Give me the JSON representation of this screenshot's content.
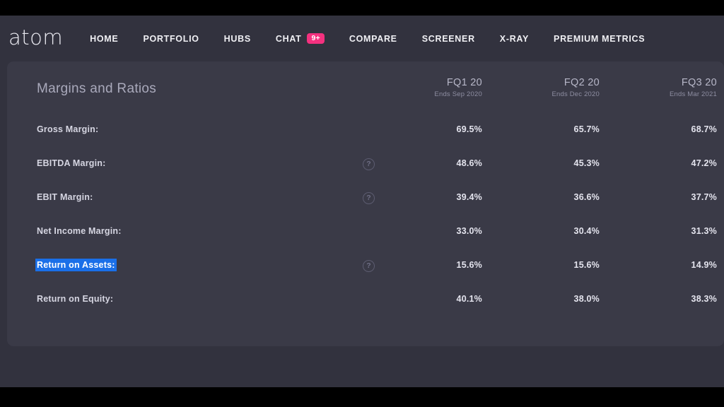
{
  "brand": {
    "logo": "atom"
  },
  "nav": {
    "items": [
      {
        "label": "HOME",
        "badge": null
      },
      {
        "label": "PORTFOLIO",
        "badge": null
      },
      {
        "label": "HUBS",
        "badge": null
      },
      {
        "label": "CHAT",
        "badge": "9+"
      },
      {
        "label": "COMPARE",
        "badge": null
      },
      {
        "label": "SCREENER",
        "badge": null
      },
      {
        "label": "X-RAY",
        "badge": null
      },
      {
        "label": "PREMIUM METRICS",
        "badge": null
      }
    ]
  },
  "panel": {
    "section_title": "Margins and Ratios",
    "columns": [
      {
        "period": "FQ1 20",
        "ends": "Ends Sep 2020"
      },
      {
        "period": "FQ2 20",
        "ends": "Ends Dec 2020"
      },
      {
        "period": "FQ3 20",
        "ends": "Ends Mar 2021"
      }
    ],
    "rows": [
      {
        "label": "Gross Margin:",
        "help": false,
        "selected": false,
        "values": [
          "69.5%",
          "65.7%",
          "68.7%"
        ]
      },
      {
        "label": "EBITDA Margin:",
        "help": true,
        "selected": false,
        "values": [
          "48.6%",
          "45.3%",
          "47.2%"
        ]
      },
      {
        "label": "EBIT Margin:",
        "help": true,
        "selected": false,
        "values": [
          "39.4%",
          "36.6%",
          "37.7%"
        ]
      },
      {
        "label": "Net Income Margin:",
        "help": false,
        "selected": false,
        "values": [
          "33.0%",
          "30.4%",
          "31.3%"
        ]
      },
      {
        "label": "Return on Assets:",
        "help": true,
        "selected": true,
        "values": [
          "15.6%",
          "15.6%",
          "14.9%"
        ]
      },
      {
        "label": "Return on Equity:",
        "help": false,
        "selected": false,
        "values": [
          "40.1%",
          "38.0%",
          "38.3%"
        ]
      }
    ],
    "help_glyph": "?"
  },
  "colors": {
    "accent_badge": "#f4317f",
    "selection": "#1a6fe8",
    "panel_bg": "#3a3a47",
    "nav_bg": "#32323e"
  }
}
